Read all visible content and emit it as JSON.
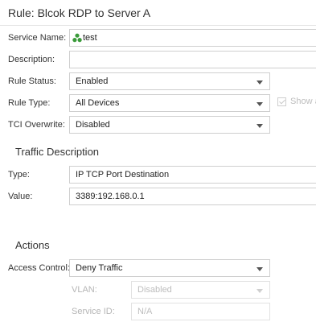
{
  "rule": {
    "title": "Rule: Blcok RDP to Server A"
  },
  "form": {
    "service_name": {
      "label": "Service Name:",
      "value": "test",
      "icon": "service-icon",
      "icon_color": "#3a9b3a"
    },
    "description": {
      "label": "Description:",
      "value": ""
    },
    "rule_status": {
      "label": "Rule Status:",
      "value": "Enabled"
    },
    "rule_type": {
      "label": "Rule Type:",
      "value": "All Devices",
      "show_all_label": "Show a"
    },
    "tci_overwrite": {
      "label": "TCI Overwrite:",
      "value": "Disabled"
    }
  },
  "traffic": {
    "heading": "Traffic Description",
    "type": {
      "label": "Type:",
      "value": "IP TCP Port Destination"
    },
    "value": {
      "label": "Value:",
      "value": "3389:192.168.0.1"
    }
  },
  "actions": {
    "heading": "Actions",
    "access_control": {
      "label": "Access Control:",
      "value": "Deny Traffic"
    },
    "vlan": {
      "label": "VLAN:",
      "value": "Disabled"
    },
    "service_id": {
      "label": "Service ID:",
      "value": "N/A"
    }
  }
}
